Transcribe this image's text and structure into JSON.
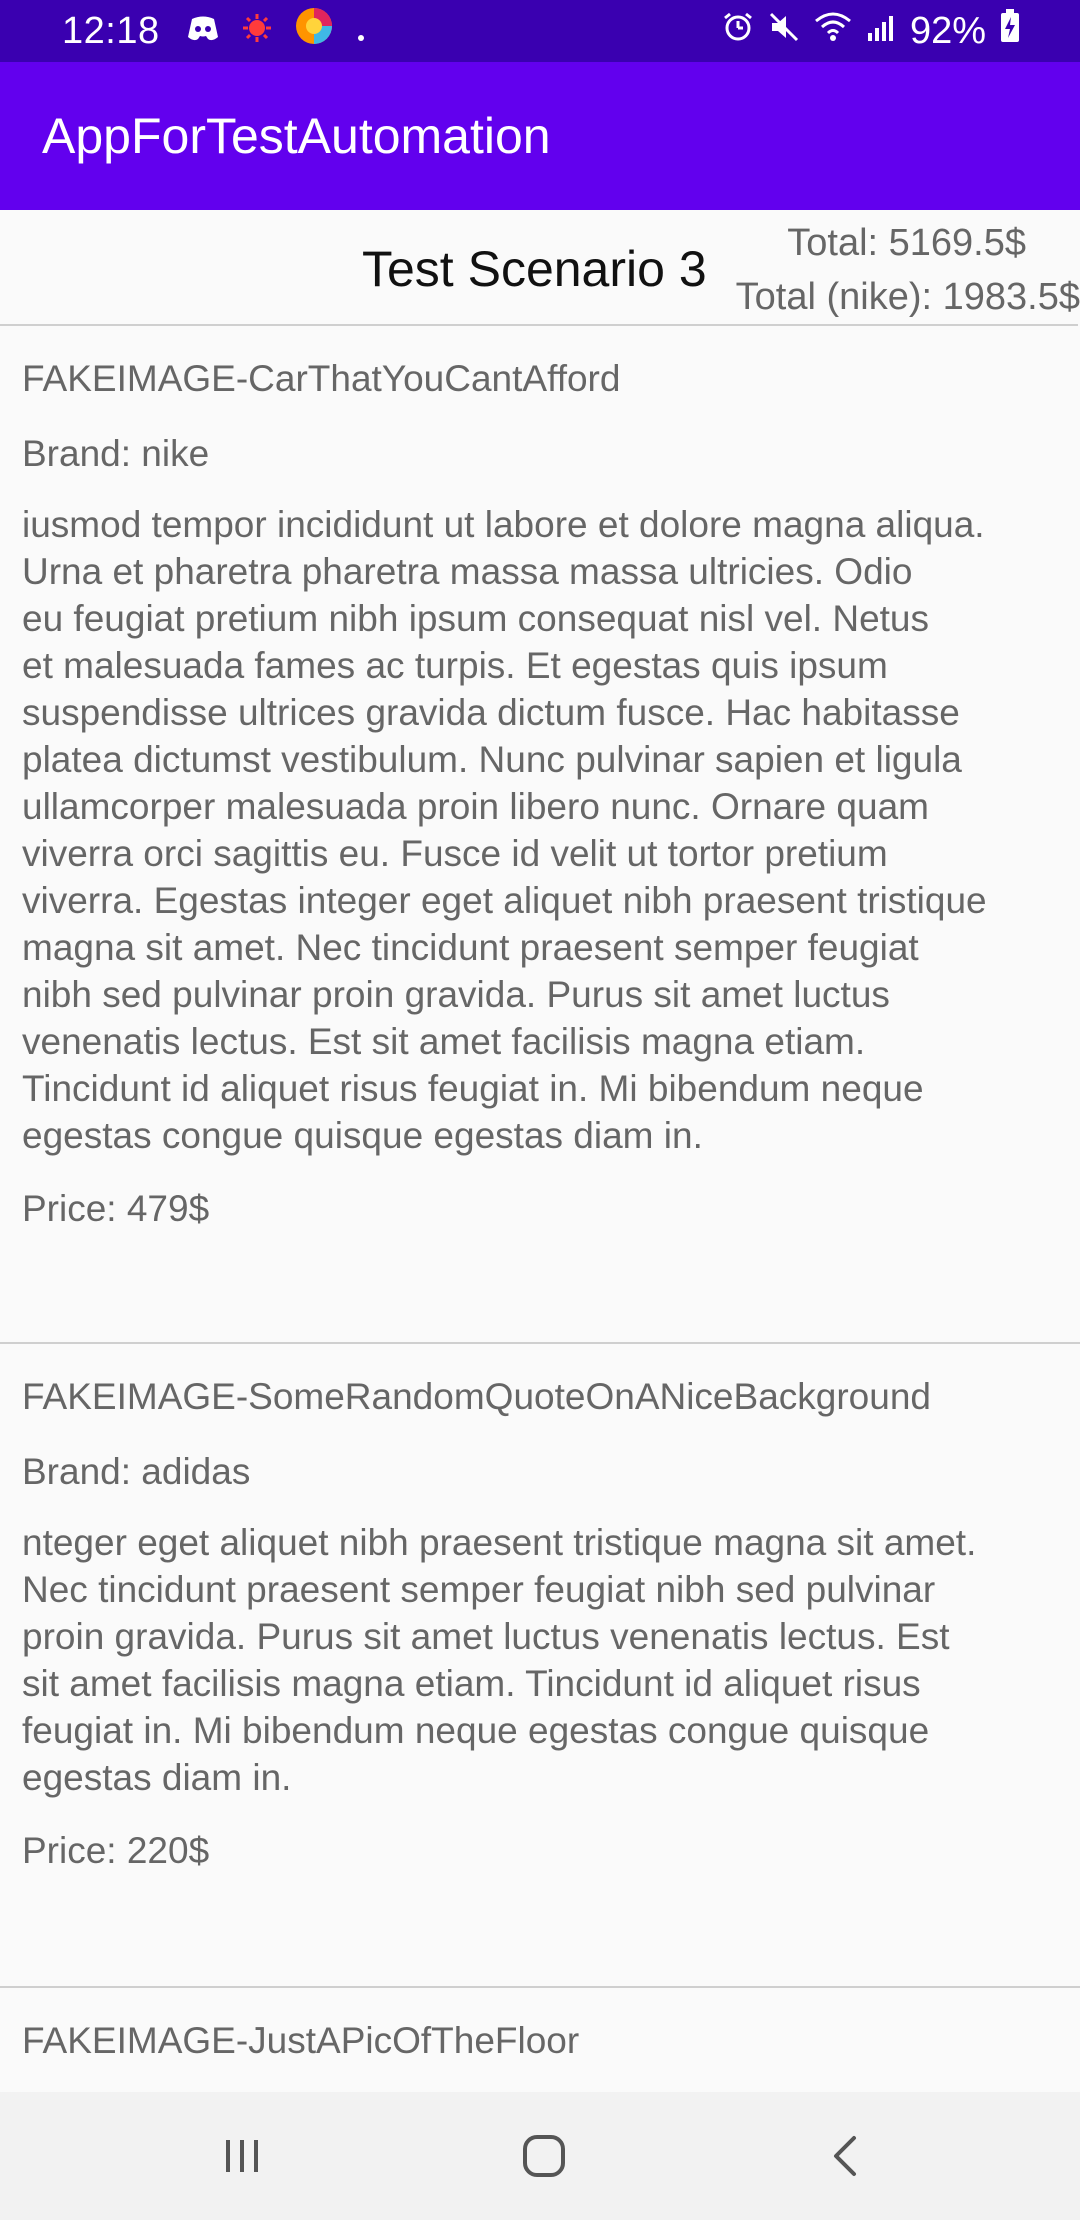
{
  "status": {
    "time": "12:18",
    "battery": "92%",
    "icons_left": [
      "discord-icon",
      "virus-icon",
      "firefox-icon",
      "dot-icon"
    ],
    "icons_right": [
      "alarm-icon",
      "mute-icon",
      "wifi-icon",
      "signal-icon",
      "battery-charging-icon"
    ]
  },
  "appbar": {
    "title": "AppForTestAutomation"
  },
  "header": {
    "scenario_title": "Test Scenario 3",
    "total": "Total: 5169.5$",
    "total_nike": "Total (nike): 1983.5$"
  },
  "items": [
    {
      "image": "FAKEIMAGE-CarThatYouCantAfford",
      "brand": "Brand: nike",
      "description": "iusmod tempor incididunt ut labore et dolore magna aliqua.\nUrna et pharetra pharetra massa massa ultricies. Odio\neu feugiat pretium nibh ipsum consequat nisl vel. Netus\net malesuada fames ac turpis. Et egestas quis ipsum\nsuspendisse ultrices gravida dictum fusce. Hac habitasse\nplatea dictumst vestibulum. Nunc pulvinar sapien et ligula\nullamcorper malesuada proin libero nunc. Ornare quam\nviverra orci sagittis eu. Fusce id velit ut tortor pretium\nviverra. Egestas integer eget aliquet nibh praesent tristique\nmagna sit amet. Nec tincidunt praesent semper feugiat\nnibh sed pulvinar proin gravida. Purus sit amet luctus\nvenenatis lectus. Est sit amet facilisis magna etiam.\nTincidunt id aliquet risus feugiat in. Mi bibendum neque\negestas congue quisque egestas diam in.",
      "price": "Price: 479$"
    },
    {
      "image": "FAKEIMAGE-SomeRandomQuoteOnANiceBackground",
      "brand": "Brand: adidas",
      "description": "nteger eget aliquet nibh praesent tristique magna sit amet.\nNec tincidunt praesent semper feugiat nibh sed pulvinar\nproin gravida. Purus sit amet luctus venenatis lectus. Est\nsit amet facilisis magna etiam. Tincidunt id aliquet risus\nfeugiat in. Mi bibendum neque egestas congue quisque\negestas diam in.",
      "price": "Price: 220$"
    },
    {
      "image": "FAKEIMAGE-JustAPicOfTheFloor"
    }
  ],
  "navbar": {
    "buttons": [
      "recent-apps-icon",
      "home-icon",
      "back-icon"
    ]
  },
  "colors": {
    "status_bar": "#3a00b0",
    "app_bar": "#6200ee",
    "background": "#fafafa",
    "nav_bar": "#f2f2f2"
  }
}
